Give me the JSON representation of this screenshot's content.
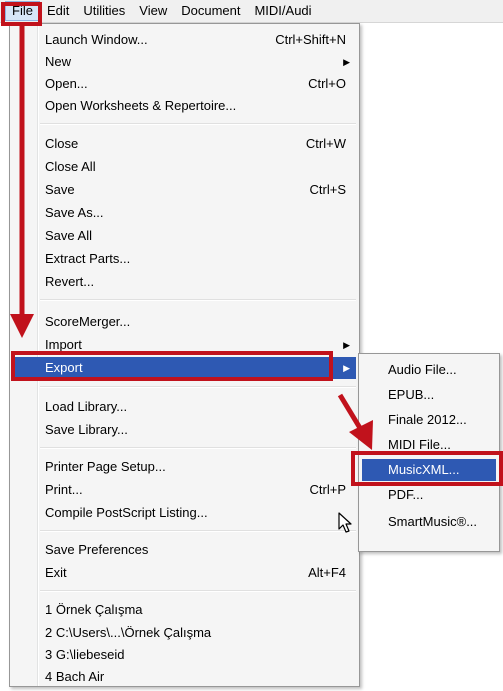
{
  "menubar": {
    "items": [
      "File",
      "Edit",
      "Utilities",
      "View",
      "Document",
      "MIDI/Audi"
    ]
  },
  "file_menu": {
    "items": [
      {
        "label": "Launch Window...",
        "shortcut": "Ctrl+Shift+N"
      },
      {
        "label": "New",
        "submenu": true
      },
      {
        "label": "Open...",
        "shortcut": "Ctrl+O"
      },
      {
        "label": "Open Worksheets & Repertoire..."
      },
      {
        "label": "Close",
        "shortcut": "Ctrl+W"
      },
      {
        "label": "Close All"
      },
      {
        "label": "Save",
        "shortcut": "Ctrl+S"
      },
      {
        "label": "Save As..."
      },
      {
        "label": "Save All"
      },
      {
        "label": "Extract Parts..."
      },
      {
        "label": "Revert..."
      },
      {
        "label": "ScoreMerger..."
      },
      {
        "label": "Import",
        "submenu": true
      },
      {
        "label": "Export",
        "submenu": true,
        "highlighted": true
      },
      {
        "label": "Load Library..."
      },
      {
        "label": "Save Library..."
      },
      {
        "label": "Printer Page Setup..."
      },
      {
        "label": "Print...",
        "shortcut": "Ctrl+P"
      },
      {
        "label": "Compile PostScript Listing..."
      },
      {
        "label": "Save Preferences"
      },
      {
        "label": "Exit",
        "shortcut": "Alt+F4"
      },
      {
        "label": "1 Örnek Çalışma"
      },
      {
        "label": "2 C:\\Users\\...\\Örnek Çalışma"
      },
      {
        "label": "3 G:\\liebeseid"
      },
      {
        "label": "4 Bach Air"
      }
    ]
  },
  "export_submenu": {
    "items": [
      {
        "label": "Audio File..."
      },
      {
        "label": "EPUB..."
      },
      {
        "label": "Finale 2012..."
      },
      {
        "label": "MIDI File..."
      },
      {
        "label": "MusicXML...",
        "highlighted": true
      },
      {
        "label": "PDF..."
      },
      {
        "label": "SmartMusic®..."
      }
    ]
  },
  "colors": {
    "highlight": "#2e59b3",
    "annotation": "#c1121c"
  }
}
